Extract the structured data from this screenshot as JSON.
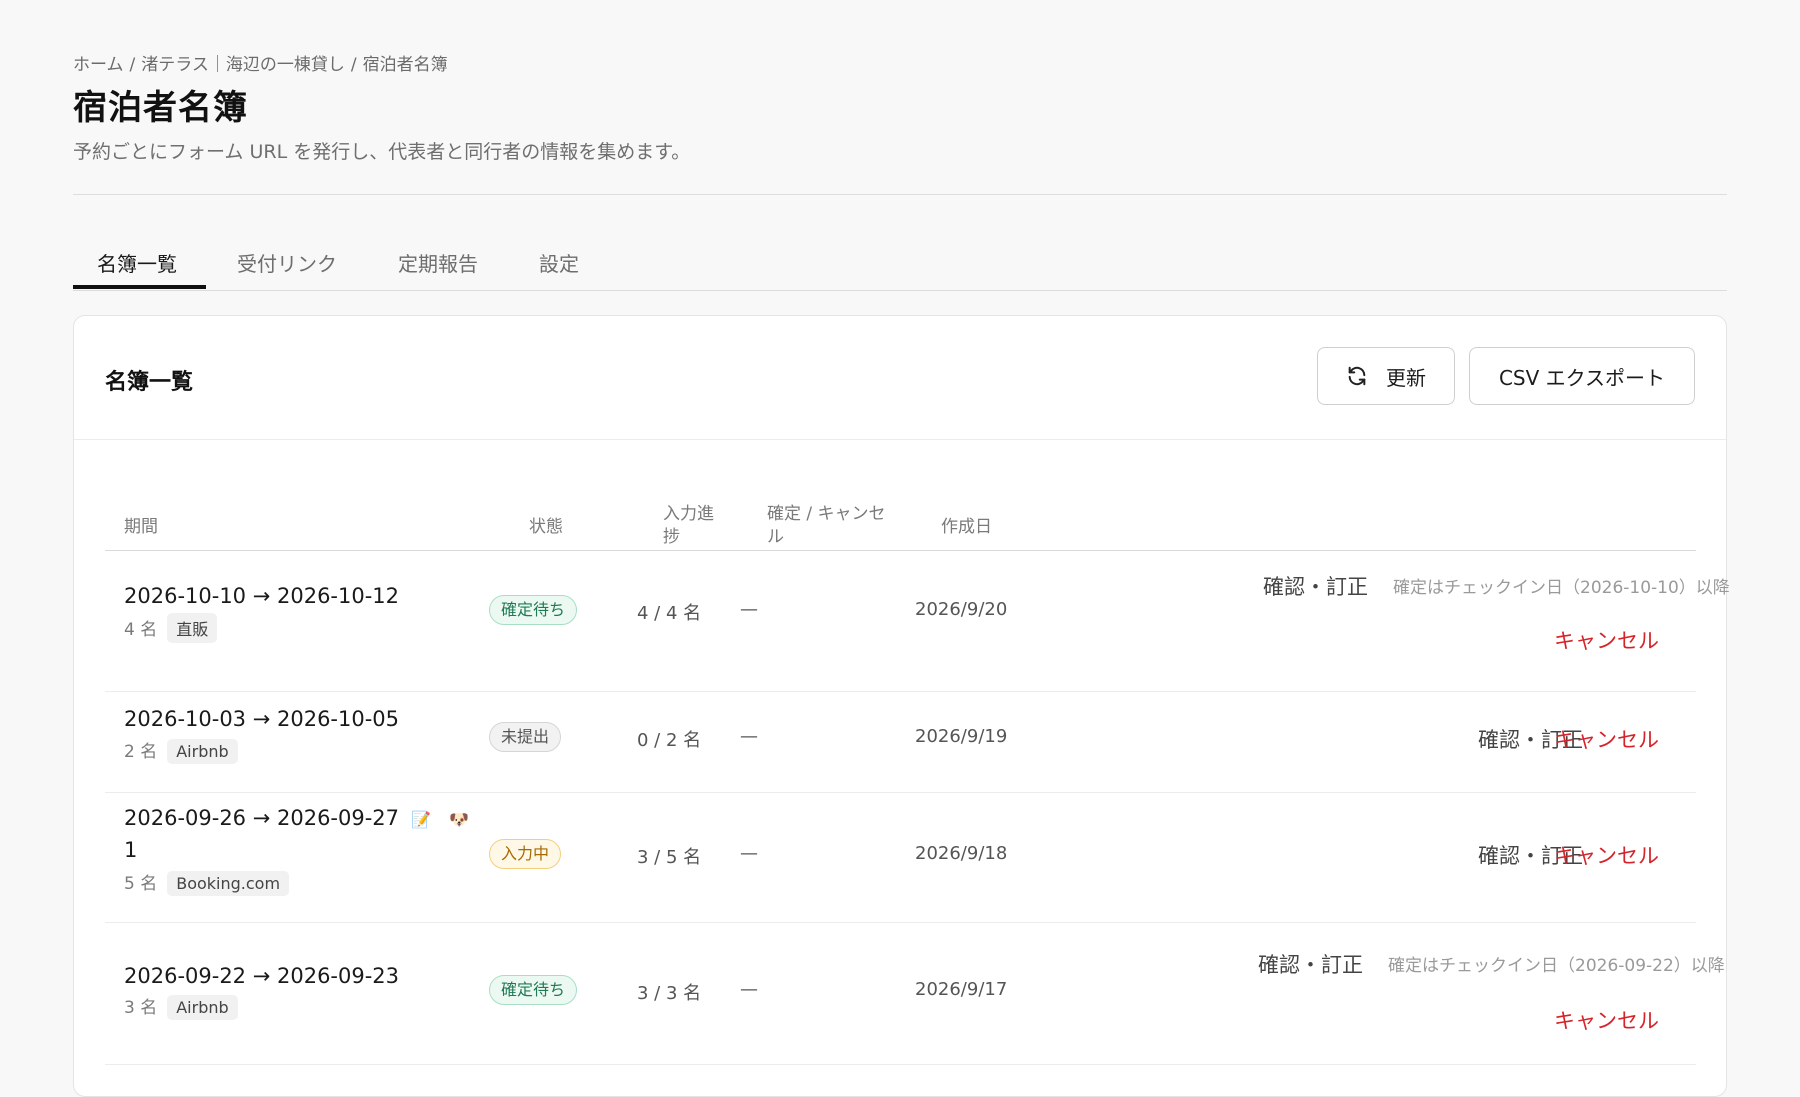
{
  "breadcrumb": [
    "ホーム",
    "渚テラス｜海辺の一棟貸し",
    "宿泊者名簿"
  ],
  "header": {
    "title": "宿泊者名簿",
    "subtitle": "予約ごとにフォーム URL を発行し、代表者と同行者の情報を集めます。"
  },
  "tabs": [
    {
      "label": "名簿一覧",
      "active": true
    },
    {
      "label": "受付リンク",
      "active": false
    },
    {
      "label": "定期報告",
      "active": false
    },
    {
      "label": "設定",
      "active": false
    }
  ],
  "card": {
    "title": "名簿一覧",
    "refresh_label": "更新",
    "csv_label": "CSV エクスポート"
  },
  "table": {
    "headers": {
      "period": "期間",
      "status": "状態",
      "progress_1": "入力進",
      "progress_2": "捗",
      "confirm_1": "確定 / キャンセ",
      "confirm_2": "ル",
      "created": "作成日"
    },
    "rows": [
      {
        "period": "2026-10-10 → 2026-10-12",
        "count": "4 名",
        "channel": "直販",
        "status": "確定待ち",
        "status_kind": "pending",
        "progress": "4 / 4 名",
        "confirm_cancel": "—",
        "created": "2026/9/20",
        "verify_label": "確認・訂正",
        "note": "確定はチェックイン日（2026-10-10）以降",
        "cancel_label": "キャンセル"
      },
      {
        "period": "2026-10-03 → 2026-10-05",
        "count": "2 名",
        "channel": "Airbnb",
        "status": "未提出",
        "status_kind": "unsubmitted",
        "progress": "0 / 2 名",
        "confirm_cancel": "—",
        "created": "2026/9/19",
        "verify_label": "確認・訂正",
        "cancel_label": "キャンセル"
      },
      {
        "period": "2026-09-26 → 2026-09-27",
        "period_extra": "1",
        "emoji_note": "📝",
        "emoji_pet": "🐶",
        "count": "5 名",
        "channel": "Booking.com",
        "status": "入力中",
        "status_kind": "inprogress",
        "progress": "3 / 5 名",
        "confirm_cancel": "—",
        "created": "2026/9/18",
        "verify_label": "確認・訂正",
        "cancel_label": "キャンセル"
      },
      {
        "period": "2026-09-22 → 2026-09-23",
        "count": "3 名",
        "channel": "Airbnb",
        "status": "確定待ち",
        "status_kind": "pending",
        "progress": "3 / 3 名",
        "confirm_cancel": "—",
        "created": "2026/9/17",
        "verify_label": "確認・訂正",
        "note": "確定はチェックイン日（2026-09-22）以降",
        "cancel_label": "キャンセル"
      }
    ]
  },
  "colors": {
    "background": "#f8f8f8",
    "cancel": "#d4242a",
    "pending": "#1f7a55",
    "inprogress": "#a86a00"
  }
}
